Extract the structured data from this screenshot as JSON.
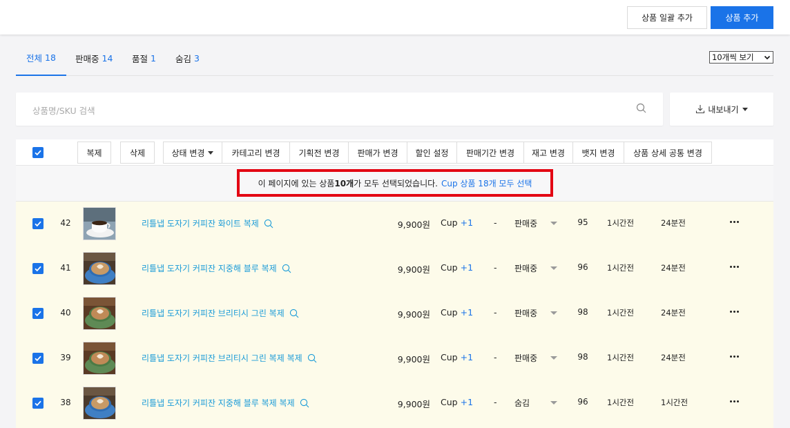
{
  "header": {
    "bulk_add_label": "상품 일괄 추가",
    "add_label": "상품 추가"
  },
  "tabs": [
    {
      "label": "전체",
      "count": "18",
      "active": true
    },
    {
      "label": "판매중",
      "count": "14",
      "active": false
    },
    {
      "label": "품절",
      "count": "1",
      "active": false
    },
    {
      "label": "숨김",
      "count": "3",
      "active": false
    }
  ],
  "page_size": {
    "selected": "10개씩 보기"
  },
  "search": {
    "placeholder": "상품명/SKU 검색"
  },
  "export": {
    "label": "내보내기"
  },
  "toolbar": {
    "duplicate": "복제",
    "delete": "삭제",
    "status_change": "상태 변경",
    "category_change": "카테고리 변경",
    "promotion_change": "기획전 변경",
    "price_change": "판매가 변경",
    "discount": "할인 설정",
    "sale_period": "판매기간 변경",
    "stock_change": "재고 변경",
    "badge_change": "뱃지 변경",
    "detail_common": "상품 상세 공통 변경"
  },
  "notice": {
    "prefix": "이 페이지에 있는 상품 ",
    "count": "10개",
    "suffix": "가 모두 선택되었습니다.",
    "link": "Cup 상품 18개 모두 선택"
  },
  "colors": {
    "accent": "#1a73e8",
    "link": "#1a9bd7",
    "highlight_border": "#e30613",
    "selected_row_bg": "#fdfbea"
  },
  "products": [
    {
      "id": "42",
      "name": "리틀냅 도자기 커피잔 화이트 복제",
      "price": "9,900원",
      "category": "Cup",
      "category_more": "+1",
      "option": "-",
      "status": "판매중",
      "stock": "95",
      "created": "1시간전",
      "updated": "24분전",
      "thumb": "white-cup"
    },
    {
      "id": "41",
      "name": "리틀냅 도자기 커피잔 지중해 블루 복제",
      "price": "9,900원",
      "category": "Cup",
      "category_more": "+1",
      "option": "-",
      "status": "판매중",
      "stock": "96",
      "created": "1시간전",
      "updated": "24분전",
      "thumb": "blue-cup"
    },
    {
      "id": "40",
      "name": "리틀냅 도자기 커피잔 브리티시 그린 복제",
      "price": "9,900원",
      "category": "Cup",
      "category_more": "+1",
      "option": "-",
      "status": "판매중",
      "stock": "98",
      "created": "1시간전",
      "updated": "24분전",
      "thumb": "green-cup"
    },
    {
      "id": "39",
      "name": "리틀냅 도자기 커피잔 브리티시 그린 복제 복제",
      "price": "9,900원",
      "category": "Cup",
      "category_more": "+1",
      "option": "-",
      "status": "판매중",
      "stock": "98",
      "created": "1시간전",
      "updated": "24분전",
      "thumb": "green-cup"
    },
    {
      "id": "38",
      "name": "리틀냅 도자기 커피잔 지중해 블루 복제 복제",
      "price": "9,900원",
      "category": "Cup",
      "category_more": "+1",
      "option": "-",
      "status": "숨김",
      "stock": "96",
      "created": "1시간전",
      "updated": "1시간전",
      "thumb": "blue-cup"
    }
  ]
}
